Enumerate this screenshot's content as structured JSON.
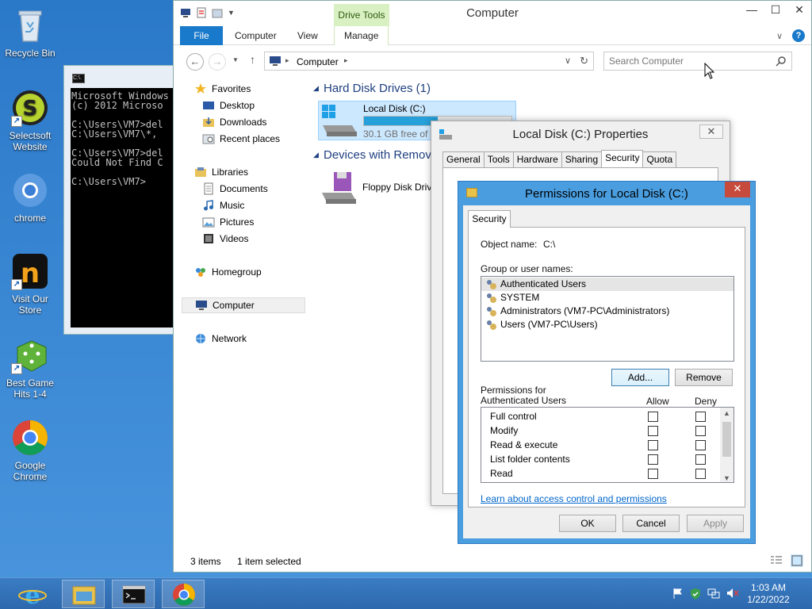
{
  "desktop": {
    "icons": [
      {
        "label": "Recycle Bin"
      },
      {
        "label": "Selectsoft Website"
      },
      {
        "label": "chrome"
      },
      {
        "label": "Visit Our Store"
      },
      {
        "label": "Best Game Hits 1-4"
      },
      {
        "label": "Google Chrome"
      }
    ]
  },
  "cmd": {
    "icon_text": "C:\\.",
    "lines": "Microsoft Windows\n(c) 2012 Microso\n\nC:\\Users\\VM7>del\nC:\\Users\\VM7\\*, \n\nC:\\Users\\VM7>del\nCould Not Find C\n\nC:\\Users\\VM7>"
  },
  "explorer": {
    "title": "Computer",
    "drive_tools": "Drive Tools",
    "tabs": {
      "file": "File",
      "computer": "Computer",
      "view": "View",
      "manage": "Manage"
    },
    "address": "Computer",
    "search_placeholder": "Search Computer",
    "nav": {
      "favorites": "Favorites",
      "desktop": "Desktop",
      "downloads": "Downloads",
      "recent": "Recent places",
      "libraries": "Libraries",
      "documents": "Documents",
      "music": "Music",
      "pictures": "Pictures",
      "videos": "Videos",
      "homegroup": "Homegroup",
      "computer": "Computer",
      "network": "Network"
    },
    "groups": {
      "hdd": "Hard Disk Drives (1)",
      "removable": "Devices with Remova"
    },
    "drives": {
      "local_name": "Local Disk (C:)",
      "local_free": "30.1 GB free of 5",
      "floppy_name": "Floppy Disk Drive"
    },
    "status": {
      "items": "3 items",
      "selected": "1 item selected"
    }
  },
  "props": {
    "title": "Local Disk (C:) Properties",
    "tabs": [
      "General",
      "Tools",
      "Hardware",
      "Sharing",
      "Security",
      "Quota"
    ],
    "active_tab": "Security"
  },
  "perm": {
    "title": "Permissions for Local Disk (C:)",
    "tab": "Security",
    "object_label": "Object name:",
    "object_value": "C:\\",
    "group_label": "Group or user names:",
    "users": [
      "Authenticated Users",
      "SYSTEM",
      "Administrators (VM7-PC\\Administrators)",
      "Users (VM7-PC\\Users)"
    ],
    "add": "Add...",
    "remove": "Remove",
    "perms_for": "Permissions for Authenticated Users",
    "allow": "Allow",
    "deny": "Deny",
    "permissions": [
      "Full control",
      "Modify",
      "Read & execute",
      "List folder contents",
      "Read"
    ],
    "learn_link": "Learn about access control and permissions",
    "ok": "OK",
    "cancel": "Cancel",
    "apply": "Apply"
  },
  "taskbar": {
    "time": "1:03 AM",
    "date": "1/22/2022"
  }
}
